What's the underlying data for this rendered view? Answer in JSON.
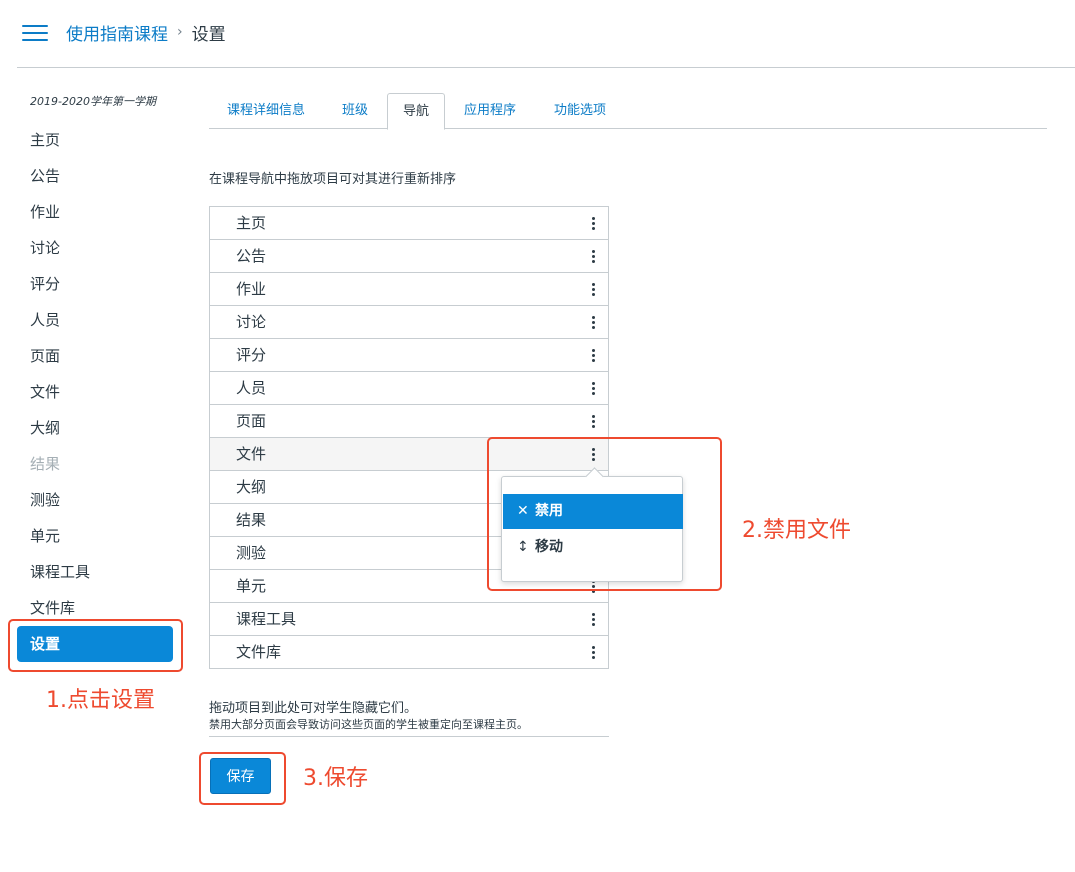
{
  "header": {
    "course_name": "使用指南课程",
    "separator": "›",
    "current_page": "设置"
  },
  "sidebar": {
    "term": "2019-2020学年第一学期",
    "items": [
      {
        "label": "主页"
      },
      {
        "label": "公告"
      },
      {
        "label": "作业"
      },
      {
        "label": "讨论"
      },
      {
        "label": "评分"
      },
      {
        "label": "人员"
      },
      {
        "label": "页面"
      },
      {
        "label": "文件"
      },
      {
        "label": "大纲"
      },
      {
        "label": "结果"
      },
      {
        "label": "测验"
      },
      {
        "label": "单元"
      },
      {
        "label": "课程工具"
      },
      {
        "label": "文件库"
      }
    ],
    "active_item": "设置"
  },
  "tabs": [
    {
      "label": "课程详细信息"
    },
    {
      "label": "班级"
    },
    {
      "label": "导航"
    },
    {
      "label": "应用程序"
    },
    {
      "label": "功能选项"
    }
  ],
  "navigation": {
    "instruction": "在课程导航中拖放项目可对其进行重新排序",
    "items": [
      {
        "label": "主页"
      },
      {
        "label": "公告"
      },
      {
        "label": "作业"
      },
      {
        "label": "讨论"
      },
      {
        "label": "评分"
      },
      {
        "label": "人员"
      },
      {
        "label": "页面"
      },
      {
        "label": "文件"
      },
      {
        "label": "大纲"
      },
      {
        "label": "结果"
      },
      {
        "label": "测验"
      },
      {
        "label": "单元"
      },
      {
        "label": "课程工具"
      },
      {
        "label": "文件库"
      }
    ],
    "menu": {
      "disable_icon": "✕",
      "disable_label": "禁用",
      "move_icon": "↕",
      "move_label": "移动"
    },
    "hidden_text": "拖动项目到此处可对学生隐藏它们。",
    "hidden_note": "禁用大部分页面会导致访问这些页面的学生被重定向至课程主页。",
    "save_label": "保存"
  },
  "annotations": {
    "step1": "1.点击设置",
    "step2": "2.禁用文件",
    "step3": "3.保存",
    "color": "#ee4a2f"
  },
  "colors": {
    "accent": "#0a88d8",
    "link": "#0c7cc7",
    "text": "#2d3b45",
    "disabled_text": "#a5afb5",
    "border": "#c7cdd1"
  }
}
